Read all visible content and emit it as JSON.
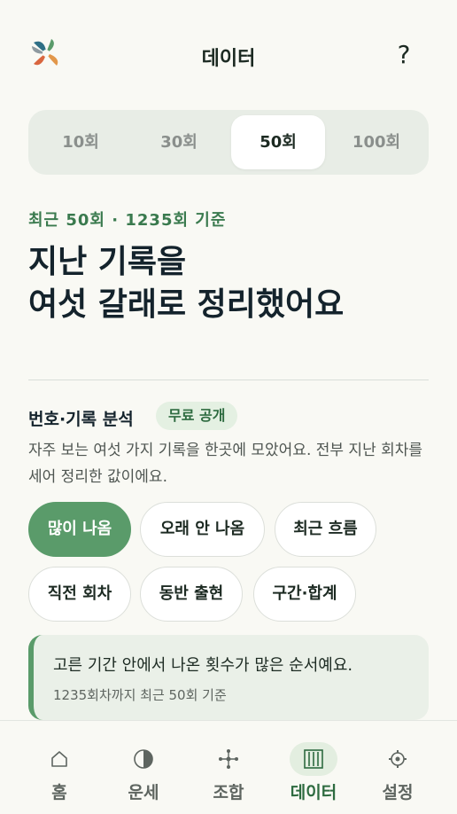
{
  "header": {
    "title": "데이터",
    "help_label": "?"
  },
  "range_tabs": [
    "10회",
    "30회",
    "50회",
    "100회"
  ],
  "range_selected": "50회",
  "intro": {
    "eyebrow": "최근 50회 · 1235회 기준",
    "headline_line1": "지난 기록을",
    "headline_line2": "여섯 갈래로 정리했어요"
  },
  "section": {
    "title": "번호·기록 분석",
    "badge": "무료 공개",
    "description": "자주 보는 여섯 가지 기록을 한곳에 모았어요. 전부 지난 회차를 세어 정리한 값이에요."
  },
  "chips": [
    "많이 나옴",
    "오래 안 나옴",
    "최근 흐름",
    "직전 회차",
    "동반 출현",
    "구간·합계"
  ],
  "chip_selected": "많이 나옴",
  "info": {
    "main": "고른 기간 안에서 나온 횟수가 많은 순서예요.",
    "sub": "1235회차까지 최근 50회 기준"
  },
  "nav": [
    {
      "label": "홈",
      "icon": "home-icon"
    },
    {
      "label": "운세",
      "icon": "half-moon-icon"
    },
    {
      "label": "조합",
      "icon": "cross-nodes-icon"
    },
    {
      "label": "데이터",
      "icon": "bars-icon"
    },
    {
      "label": "설정",
      "icon": "gear-icon"
    }
  ],
  "nav_active": "데이터",
  "colors": {
    "accent": "#5a9b6a",
    "accent_dark": "#2e6b40",
    "background": "#f9f9f4"
  }
}
